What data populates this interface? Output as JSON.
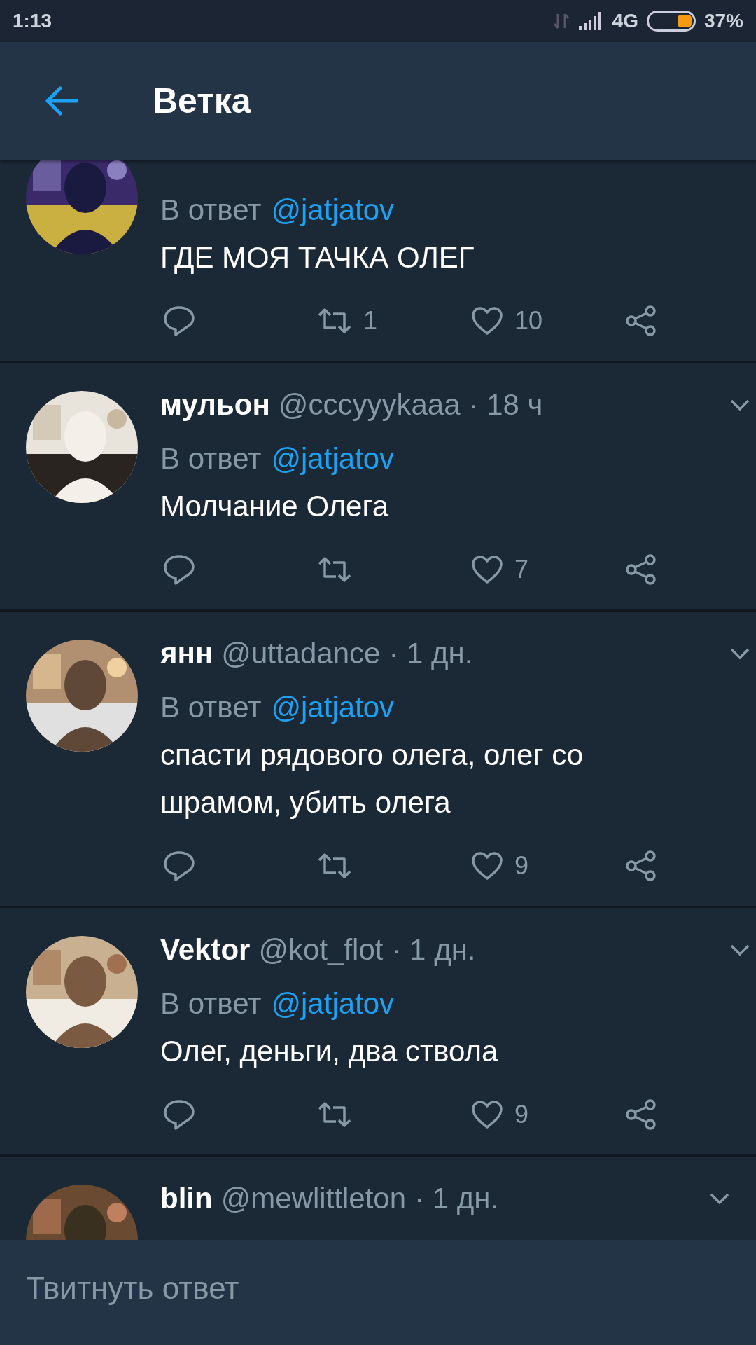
{
  "status_bar": {
    "time": "1:13",
    "network": "4G",
    "battery": "37%"
  },
  "app_bar": {
    "title": "Ветка"
  },
  "tweets": [
    {
      "reply_label": "В ответ",
      "reply_to": "@jatjatov",
      "text": "ГДЕ МОЯ ТАЧКА ОЛЕГ",
      "retweets": "1",
      "likes": "10"
    },
    {
      "name": "мульон",
      "handle": "@cccyyykaaa",
      "time": "· 18 ч",
      "reply_label": "В ответ",
      "reply_to": "@jatjatov",
      "text": "Молчание Олега",
      "likes": "7"
    },
    {
      "name": "янн",
      "handle": "@uttadance",
      "time": "· 1 дн.",
      "reply_label": "В ответ",
      "reply_to": "@jatjatov",
      "text": "спасти рядового олега, олег со шрамом, убить олега",
      "likes": "9"
    },
    {
      "name": "Vektor",
      "handle": "@kot_flot",
      "time": "· 1 дн.",
      "reply_label": "В ответ",
      "reply_to": "@jatjatov",
      "text": "Олег, деньги, два ствола",
      "likes": "9"
    },
    {
      "name": "blin",
      "handle": "@mewlittleton",
      "time": "· 1 дн."
    }
  ],
  "reply_field": {
    "placeholder": "Твитнуть ответ"
  }
}
